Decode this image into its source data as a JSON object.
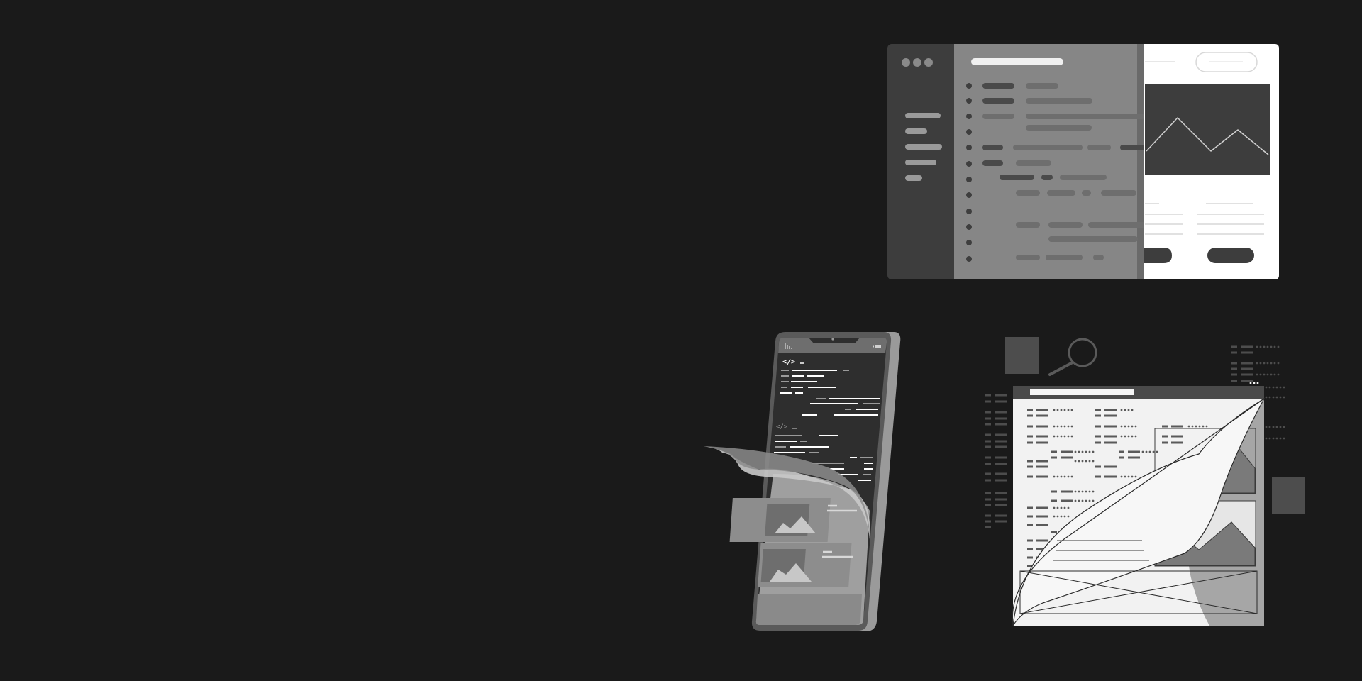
{
  "page": {
    "background": "#1a1a1a"
  },
  "palette": {
    "bg": "#1a1a1a",
    "dark_panel": "#3d3d3d",
    "mid_panel": "#868686",
    "divider": "#6a6a6a",
    "light": "#ffffff",
    "line_light": "#b5b5b5",
    "line_mid": "#6e6e6e",
    "line_dark": "#4a4a4a",
    "phone_frame": "#5a5a5a",
    "phone_screen": "#2e2e2e",
    "phone_back": "#9a9a9a",
    "doc_paper": "#f2f2f2",
    "doc_curl": "#a6a6a6",
    "accent_square": "#4d4d4d"
  },
  "illustration": {
    "desktop_window": {
      "icons": [
        "window-dots-icon",
        "chart-mountain-icon"
      ]
    },
    "phone": {
      "icons": [
        "code-brackets-icon",
        "signal-bars-icon",
        "battery-icon",
        "image-placeholder-icon"
      ],
      "code_glyph": "</>"
    },
    "document": {
      "icons": [
        "magnifier-icon",
        "page-curl-icon",
        "image-placeholder-icon"
      ]
    }
  }
}
